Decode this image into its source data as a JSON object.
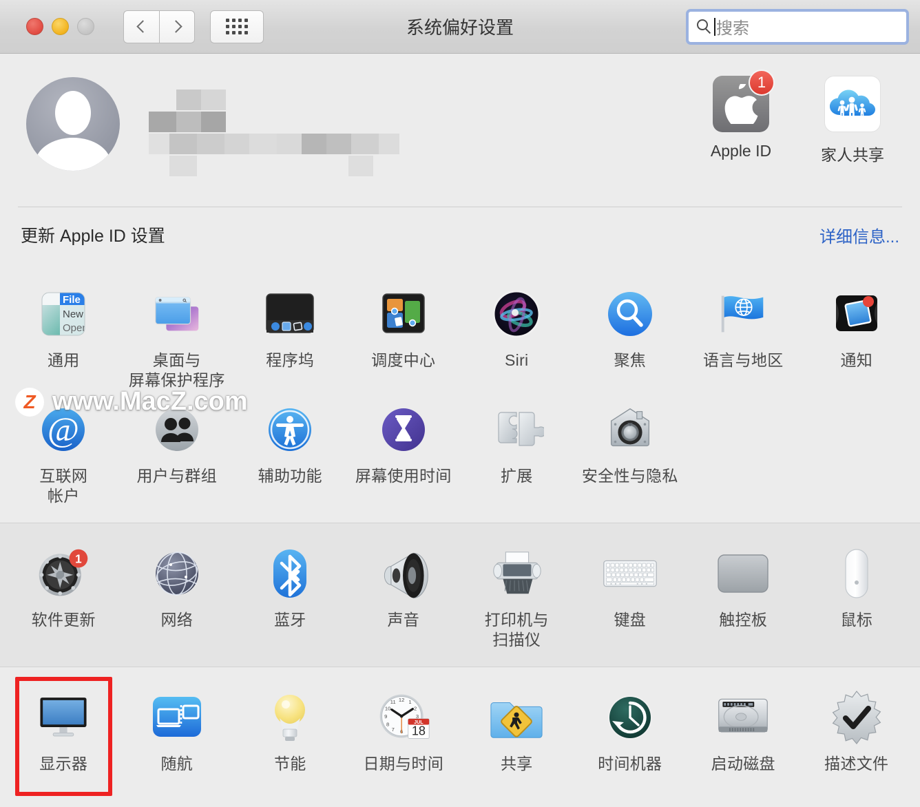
{
  "window": {
    "title": "系统偏好设置",
    "traffic_lights": [
      "close-red",
      "minimize-yellow",
      "zoom-gray-disabled"
    ],
    "nav": {
      "back": "back-chevron",
      "forward": "forward-chevron",
      "grid": "show-all-grid"
    }
  },
  "search": {
    "placeholder": "搜索",
    "value": "",
    "focused": true,
    "icon": "search-icon"
  },
  "apple_id": {
    "avatar": "default-user-avatar",
    "name_redacted": true,
    "items": [
      {
        "label": "Apple ID",
        "icon": "apple-logo-icon",
        "badge": "1"
      },
      {
        "label": "家人共享",
        "icon": "family-sharing-icon",
        "badge": ""
      }
    ],
    "update_label": "更新 Apple ID 设置",
    "details_link": "详细信息..."
  },
  "sections": [
    {
      "name": "personal",
      "rows": [
        [
          {
            "label": "通用",
            "icon": "general-icon"
          },
          {
            "label": "桌面与\n屏幕保护程序",
            "icon": "desktop-screensaver-icon"
          },
          {
            "label": "程序坞",
            "icon": "dock-icon"
          },
          {
            "label": "调度中心",
            "icon": "mission-control-icon"
          },
          {
            "label": "Siri",
            "icon": "siri-icon"
          },
          {
            "label": "聚焦",
            "icon": "spotlight-icon"
          },
          {
            "label": "语言与地区",
            "icon": "language-region-icon"
          },
          {
            "label": "通知",
            "icon": "notifications-icon"
          }
        ],
        [
          {
            "label": "互联网\n帐户",
            "icon": "internet-accounts-icon"
          },
          {
            "label": "用户与群组",
            "icon": "users-groups-icon"
          },
          {
            "label": "辅助功能",
            "icon": "accessibility-icon"
          },
          {
            "label": "屏幕使用时间",
            "icon": "screen-time-icon"
          },
          {
            "label": "扩展",
            "icon": "extensions-icon"
          },
          {
            "label": "安全性与隐私",
            "icon": "security-privacy-icon"
          }
        ]
      ]
    },
    {
      "name": "hardware",
      "rows": [
        [
          {
            "label": "软件更新",
            "icon": "software-update-icon",
            "badge": "1"
          },
          {
            "label": "网络",
            "icon": "network-icon"
          },
          {
            "label": "蓝牙",
            "icon": "bluetooth-icon"
          },
          {
            "label": "声音",
            "icon": "sound-icon"
          },
          {
            "label": "打印机与\n扫描仪",
            "icon": "printers-scanners-icon"
          },
          {
            "label": "键盘",
            "icon": "keyboard-icon"
          },
          {
            "label": "触控板",
            "icon": "trackpad-icon"
          },
          {
            "label": "鼠标",
            "icon": "mouse-icon"
          }
        ]
      ]
    },
    {
      "name": "system",
      "rows": [
        [
          {
            "label": "显示器",
            "icon": "displays-icon",
            "selected": true
          },
          {
            "label": "随航",
            "icon": "sidecar-icon"
          },
          {
            "label": "节能",
            "icon": "energy-saver-icon"
          },
          {
            "label": "日期与时间",
            "icon": "date-time-icon",
            "calendar_month": "JUL",
            "calendar_day": "18"
          },
          {
            "label": "共享",
            "icon": "sharing-icon"
          },
          {
            "label": "时间机器",
            "icon": "time-machine-icon"
          },
          {
            "label": "启动磁盘",
            "icon": "startup-disk-icon"
          },
          {
            "label": "描述文件",
            "icon": "profiles-icon"
          }
        ]
      ]
    }
  ],
  "watermark": {
    "logo": "z-logo-icon",
    "text": "www.MacZ.com"
  },
  "colors": {
    "accent_link": "#2c62c6",
    "badge_red": "#dc3a2f",
    "highlight_red": "#ee2222",
    "window_bg": "#ececec",
    "section_alt_bg": "#e4e4e4",
    "label_text": "#4a4a4a"
  },
  "general_icon_text": {
    "line1": "File",
    "line2": "New",
    "line3": "Open"
  }
}
